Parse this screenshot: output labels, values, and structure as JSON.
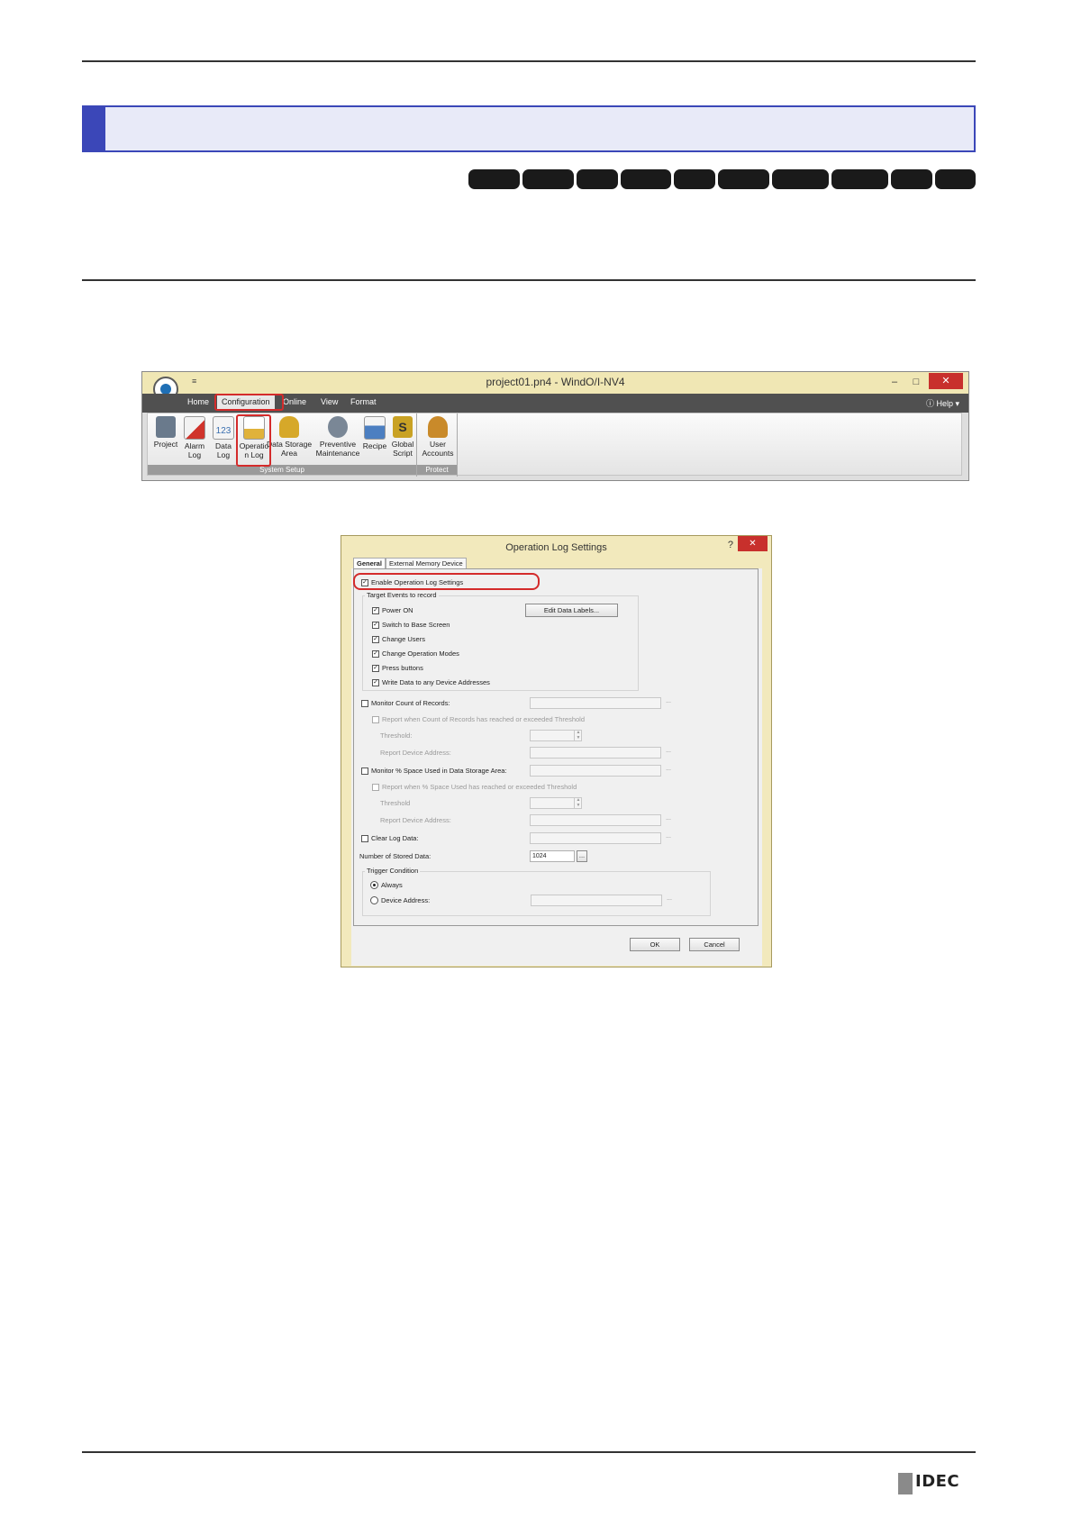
{
  "ribbon": {
    "window_title": "project01.pn4 - WindO/I-NV4",
    "quick_access": "≡",
    "tabs": [
      "Home",
      "Configuration",
      "Online",
      "View",
      "Format"
    ],
    "help_label": "Help",
    "minimize": "–",
    "maximize": "□",
    "close": "✕",
    "buttons": [
      {
        "label": "Project",
        "icon": "project-icon",
        "color": "#6a7a8c"
      },
      {
        "label": "Alarm Log",
        "icon": "alarm-log-icon",
        "color": "#d0342c"
      },
      {
        "label": "Data Log",
        "icon": "data-log-icon",
        "color": "#3a6fb0"
      },
      {
        "label": "Operatio n Log",
        "icon": "operation-log-icon",
        "color": "#e0b23a"
      },
      {
        "label": "Data Storage Area",
        "icon": "data-storage-area-icon",
        "color": "#d6a829"
      },
      {
        "label": "Preventive Maintenance",
        "icon": "preventive-maintenance-icon",
        "color": "#7a8796"
      },
      {
        "label": "Recipe",
        "icon": "recipe-icon",
        "color": "#4c7fc1"
      },
      {
        "label": "Global Script",
        "icon": "global-script-icon",
        "color": "#c9a224"
      },
      {
        "label": "User Accounts",
        "icon": "user-accounts-icon",
        "color": "#c98a2a"
      }
    ],
    "groups": [
      "System Setup",
      "Protect"
    ]
  },
  "dialog": {
    "title": "Operation Log Settings",
    "help": "?",
    "close": "✕",
    "tabs": [
      "General",
      "External Memory Device"
    ],
    "enable_label": "Enable Operation Log Settings",
    "target_events_label": "Target Events to record",
    "events": [
      "Power ON",
      "Switch to Base Screen",
      "Change Users",
      "Change Operation Modes",
      "Press buttons",
      "Write Data to any Device Addresses"
    ],
    "edit_data_labels": "Edit Data Labels...",
    "monitor_count_label": "Monitor Count of Records:",
    "report_count_label": "Report when Count of Records has reached or exceeded Threshold",
    "threshold_label": "Threshold:",
    "report_device_address_label": "Report Device Address:",
    "monitor_space_label": "Monitor % Space Used in Data Storage Area:",
    "report_space_label": "Report when % Space Used has reached or exceeded Threshold",
    "threshold_label_2": "Threshold",
    "report_device_address_label_2": "Report Device Address:",
    "clear_log_label": "Clear Log Data:",
    "stored_data_label": "Number of Stored Data:",
    "stored_data_value": "1024",
    "trigger_label": "Trigger Condition",
    "always_label": "Always",
    "device_address_label": "Device Address:",
    "ellipsis": "...",
    "ok": "OK",
    "cancel": "Cancel",
    "check": "✓",
    "spin_up": "▲",
    "spin_down": "▼"
  },
  "footer": {
    "logo": "IDEC"
  },
  "colors": {
    "heading_accent": "#3b47b8",
    "heading_fill": "#e8eaf8",
    "highlight": "#d42b2b",
    "title_bar": "#f0e7b4"
  }
}
